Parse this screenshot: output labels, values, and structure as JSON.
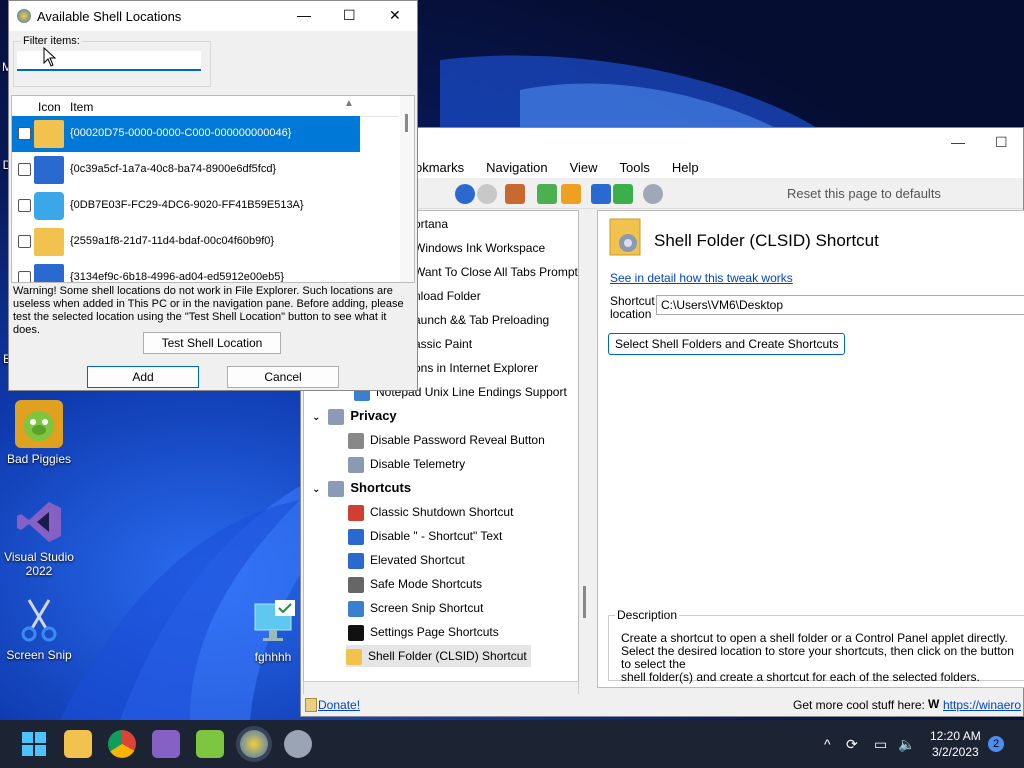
{
  "desktop": {
    "icons": [
      {
        "label": "Bad Piggies"
      },
      {
        "label": "Visual Studio 2022"
      },
      {
        "label": "Screen Snip"
      },
      {
        "label": "fghhhh"
      }
    ],
    "edge_fragments": [
      "M",
      "D",
      "E"
    ]
  },
  "dialog": {
    "title": "Available Shell Locations",
    "filter_label": "Filter items:",
    "filter_value": "",
    "columns": {
      "icon": "Icon",
      "item": "Item"
    },
    "items": [
      {
        "text": "{00020D75-0000-0000-C000-000000000046}",
        "icon": "folder-icon",
        "selected": true
      },
      {
        "text": "{0c39a5cf-1a7a-40c8-ba74-8900e6df5fcd}",
        "icon": "shortcut-icon",
        "selected": false
      },
      {
        "text": "{0DB7E03F-FC29-4DC6-9020-FF41B59E513A}",
        "icon": "3d-objects-icon",
        "selected": false
      },
      {
        "text": "{2559a1f8-21d7-11d4-bdaf-00c04f60b9f0}",
        "icon": "folder-icon",
        "selected": false
      },
      {
        "text": "{3134ef9c-6b18-4996-ad04-ed5912e00eb5}",
        "icon": "shortcut-icon",
        "selected": false
      }
    ],
    "warning": "Warning! Some shell locations do not work in File Explorer. Such locations are useless when added in This PC or in the navigation pane. Before adding, please test the selected location using the \"Test Shell Location\" button to see what it does.",
    "test_button": "Test Shell Location",
    "add_button": "Add",
    "cancel_button": "Cancel"
  },
  "main": {
    "menu": [
      "okmarks",
      "Navigation",
      "View",
      "Tools",
      "Help"
    ],
    "reset": "Reset this page to defaults",
    "tree": [
      {
        "label": "ortana",
        "type": "item"
      },
      {
        "label": "Windows Ink Workspace",
        "type": "item"
      },
      {
        "label": "Want To Close All Tabs Prompt in E",
        "type": "item"
      },
      {
        "label": "nload Folder",
        "type": "item"
      },
      {
        "label": "aunch && Tab Preloading",
        "type": "item"
      },
      {
        "label": "assic Paint",
        "type": "item"
      },
      {
        "label": "ons in Internet Explorer",
        "type": "item"
      },
      {
        "label": "Notepad Unix Line Endings Support",
        "type": "item"
      },
      {
        "label": "Privacy",
        "type": "cat"
      },
      {
        "label": "Disable Password Reveal Button",
        "type": "item"
      },
      {
        "label": "Disable Telemetry",
        "type": "item"
      },
      {
        "label": "Shortcuts",
        "type": "cat"
      },
      {
        "label": "Classic Shutdown Shortcut",
        "type": "item"
      },
      {
        "label": "Disable \" - Shortcut\" Text",
        "type": "item"
      },
      {
        "label": "Elevated Shortcut",
        "type": "item"
      },
      {
        "label": "Safe Mode Shortcuts",
        "type": "item"
      },
      {
        "label": "Screen Snip Shortcut",
        "type": "item"
      },
      {
        "label": "Settings Page Shortcuts",
        "type": "item"
      },
      {
        "label": "Shell Folder (CLSID) Shortcut",
        "type": "item"
      }
    ],
    "page_title": "Shell Folder (CLSID) Shortcut",
    "detail_link": "See in detail how this tweak works",
    "shortcut_label_1": "Shortcut",
    "shortcut_label_2": "location",
    "shortcut_value": "C:\\Users\\VM6\\Desktop",
    "select_button": "Select Shell Folders and Create Shortcuts",
    "description_header": "Description",
    "description": "Create a shortcut to open a shell folder or a Control Panel applet directly.\nSelect the desired location to store your shortcuts, then click on the button to select the\nshell folder(s) and create a shortcut for each of the selected folders.",
    "donate": "Donate!",
    "more_stuff": "Get more cool stuff here:",
    "winaero_link": "https://winaero"
  },
  "taskbar": {
    "time": "12:20 AM",
    "date": "3/2/2023",
    "notifications": "2"
  }
}
